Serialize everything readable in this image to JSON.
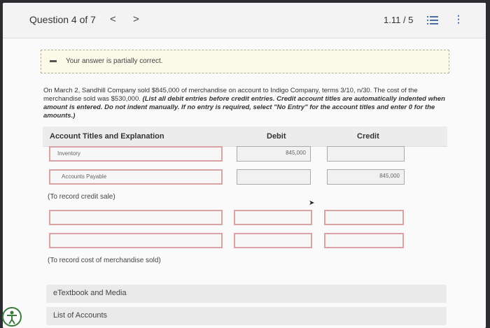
{
  "header": {
    "question_label": "Question 4 of 7",
    "prev_glyph": "<",
    "next_glyph": ">",
    "score": "1.11 / 5",
    "list_icon": "list-icon",
    "more_icon": "more-vertical-icon"
  },
  "notice": {
    "text": "Your answer is partially correct."
  },
  "problem": {
    "text": "On March 2, Sandhill Company sold $845,000 of merchandise on account to Indigo Company, terms 3/10, n/30. The cost of the merchandise sold was $530,000. ",
    "instructions": "(List all debit entries before credit entries. Credit account titles are automatically indented when amount is entered. Do not indent manually. If no entry is required, select \"No Entry\" for the account titles and enter 0 for the amounts.)"
  },
  "table": {
    "col_account": "Account Titles and Explanation",
    "col_debit": "Debit",
    "col_credit": "Credit"
  },
  "entry1": {
    "row1": {
      "account": "Inventory",
      "debit": "845,000",
      "credit": ""
    },
    "row2": {
      "account": "Accounts Payable",
      "debit": "",
      "credit": "845,000"
    },
    "note": "(To record credit sale)"
  },
  "entry2": {
    "row1": {
      "account": "",
      "debit": "",
      "credit": ""
    },
    "row2": {
      "account": "",
      "debit": "",
      "credit": ""
    },
    "note": "(To record cost of merchandise sold)"
  },
  "links": {
    "etextbook": "eTextbook and Media",
    "accounts": "List of Accounts"
  },
  "colors": {
    "error_border": "#d9a3a3",
    "notice_bg": "#fcfbea",
    "accent": "#4a6fa5"
  }
}
